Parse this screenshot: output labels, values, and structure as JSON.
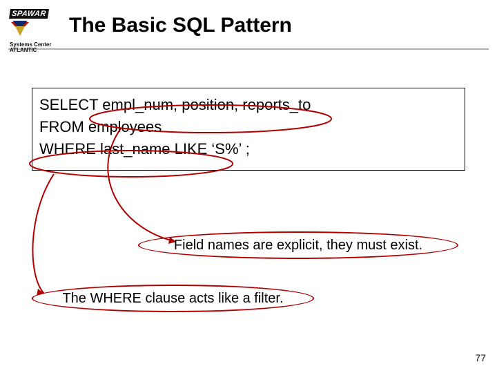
{
  "logo": {
    "top": "SPAWAR",
    "sub_line1": "Systems Center",
    "sub_line2": "ATLANTIC"
  },
  "title": "The Basic SQL Pattern",
  "sql": {
    "line1": "SELECT empl_num, position, reports_to",
    "line2": "FROM employees",
    "line3": "WHERE last_name LIKE ‘S%’ ;"
  },
  "callouts": {
    "fields": "Field names are explicit, they must exist.",
    "where": "The WHERE clause acts like a filter."
  },
  "page_number": "77",
  "accent_color": "#b00000"
}
